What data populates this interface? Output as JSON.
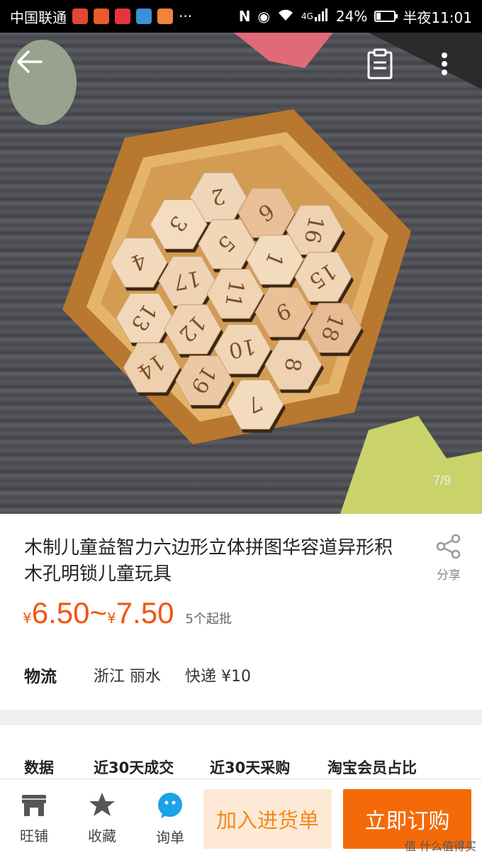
{
  "status_bar": {
    "carrier": "中国联通",
    "network": "4G",
    "battery": "24%",
    "battery_level": 0.24,
    "time": "半夜11:01"
  },
  "hero": {
    "image_counter": "7/9",
    "tiles": [
      "2",
      "6",
      "3",
      "16",
      "4",
      "5",
      "1",
      "17",
      "15",
      "13",
      "11",
      "9",
      "12",
      "18",
      "10",
      "14",
      "19",
      "8",
      "7"
    ],
    "icons": {
      "back": "back-arrow-icon",
      "clipboard": "clipboard-icon",
      "more": "more-vertical-icon"
    }
  },
  "product": {
    "title": "木制儿童益智力六边形立体拼图华容道异形积木孔明锁儿童玩具",
    "share_label": "分享",
    "price_low": "6.50",
    "price_high": "7.50",
    "currency_symbol": "¥",
    "price_separator": "~",
    "min_order": "5个起批",
    "price_color": "#f2550d"
  },
  "logistics": {
    "label": "物流",
    "origin": "浙江 丽水",
    "shipping": "快递 ¥10"
  },
  "data_section": {
    "label": "数据",
    "columns": [
      "近30天成交",
      "近30天采购",
      "淘宝会员占比"
    ]
  },
  "bottom_bar": {
    "shop_label": "旺铺",
    "favorite_label": "收藏",
    "inquiry_label": "询单",
    "add_cart_label": "加入进货单",
    "order_label": "立即订购",
    "accent": "#f46a08"
  },
  "watermark": "值 什么值得买"
}
